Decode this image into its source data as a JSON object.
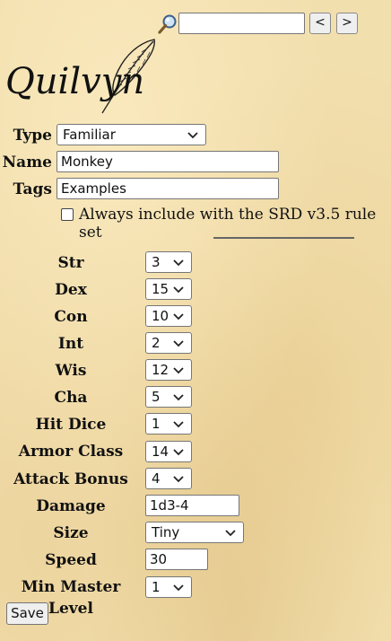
{
  "search": {
    "value": "",
    "prev_label": "<",
    "next_label": ">"
  },
  "logo_text": "Quilvyn",
  "form": {
    "type_label": "Type",
    "type_value": "Familiar",
    "name_label": "Name",
    "name_value": "Monkey",
    "tags_label": "Tags",
    "tags_value": "Examples",
    "include_label": "Always include with the SRD v3.5 rule set"
  },
  "stats": [
    {
      "label": "Str",
      "value": "3"
    },
    {
      "label": "Dex",
      "value": "15"
    },
    {
      "label": "Con",
      "value": "10"
    },
    {
      "label": "Int",
      "value": "2"
    },
    {
      "label": "Wis",
      "value": "12"
    },
    {
      "label": "Cha",
      "value": "5"
    },
    {
      "label": "Hit Dice",
      "value": "1"
    },
    {
      "label": "Armor Class",
      "value": "14"
    },
    {
      "label": "Attack Bonus",
      "value": "4"
    },
    {
      "label": "Damage",
      "value": "1d3-4"
    },
    {
      "label": "Size",
      "value": "Tiny"
    },
    {
      "label": "Speed",
      "value": "30"
    },
    {
      "label": "Min Master Level",
      "value": "1"
    }
  ],
  "save_label": "Save"
}
